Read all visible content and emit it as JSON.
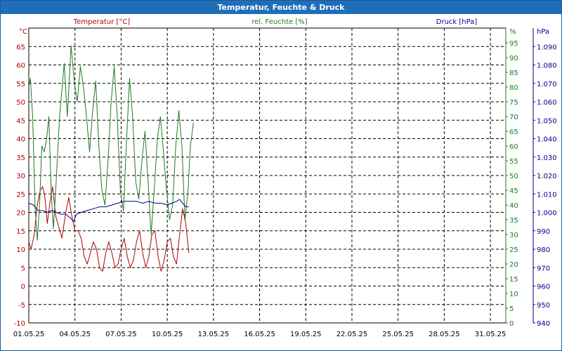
{
  "window": {
    "title": "Temperatur, Feuchte & Druck"
  },
  "colors": {
    "temperature": "#b00000",
    "humidity": "#1f7a1f",
    "pressure": "#00008b",
    "title_bar": "#1f6fb8"
  },
  "chart_data": {
    "type": "line",
    "title": "Temperatur, Feuchte & Druck",
    "grid": true,
    "x": {
      "labels": [
        "01.05.25",
        "04.05.25",
        "07.05.25",
        "10.05.25",
        "13.05.25",
        "16.05.25",
        "19.05.25",
        "22.05.25",
        "25.05.25",
        "28.05.25",
        "31.05.25"
      ],
      "start_day": 1,
      "end_day": 32
    },
    "axes": {
      "left": {
        "unit": "°C",
        "label": "Temperatur [°C]",
        "range": [
          -10,
          70
        ],
        "ticks": [
          "-10",
          "-5",
          "0",
          "5",
          "10",
          "15",
          "20",
          "25",
          "30",
          "35",
          "40",
          "45",
          "50",
          "55",
          "60",
          "65"
        ]
      },
      "middle": {
        "unit": "%",
        "label": "rel. Feuchte [%]",
        "range": [
          0,
          100
        ],
        "ticks": [
          "0",
          "5",
          "10",
          "15",
          "20",
          "25",
          "30",
          "35",
          "40",
          "45",
          "50",
          "55",
          "60",
          "65",
          "70",
          "75",
          "80",
          "85",
          "90",
          "95"
        ]
      },
      "right": {
        "unit": "hPa",
        "label": "Druck [hPa]",
        "range": [
          940,
          1100
        ],
        "ticks": [
          "940",
          "950",
          "960",
          "970",
          "980",
          "990",
          "1.000",
          "1.010",
          "1.020",
          "1.030",
          "1.040",
          "1.050",
          "1.060",
          "1.070",
          "1.080",
          "1.090"
        ]
      }
    },
    "series": [
      {
        "name": "Temperatur [°C]",
        "axis": "left",
        "color": "#b00000",
        "points": [
          [
            1.0,
            12
          ],
          [
            1.15,
            10
          ],
          [
            1.35,
            14
          ],
          [
            1.55,
            22
          ],
          [
            1.75,
            26
          ],
          [
            1.9,
            27
          ],
          [
            2.05,
            24
          ],
          [
            2.2,
            17
          ],
          [
            2.35,
            22
          ],
          [
            2.55,
            27
          ],
          [
            2.75,
            19
          ],
          [
            2.95,
            16
          ],
          [
            3.15,
            13
          ],
          [
            3.4,
            20
          ],
          [
            3.6,
            24
          ],
          [
            3.8,
            19
          ],
          [
            4.0,
            15
          ],
          [
            4.2,
            15
          ],
          [
            4.4,
            13
          ],
          [
            4.6,
            8
          ],
          [
            4.8,
            6
          ],
          [
            5.0,
            9
          ],
          [
            5.2,
            12
          ],
          [
            5.4,
            10
          ],
          [
            5.6,
            5
          ],
          [
            5.8,
            4
          ],
          [
            6.0,
            9
          ],
          [
            6.2,
            12
          ],
          [
            6.4,
            9
          ],
          [
            6.6,
            5
          ],
          [
            6.8,
            6
          ],
          [
            7.0,
            10
          ],
          [
            7.2,
            13
          ],
          [
            7.4,
            8
          ],
          [
            7.6,
            5
          ],
          [
            7.8,
            7
          ],
          [
            8.0,
            12
          ],
          [
            8.2,
            15
          ],
          [
            8.4,
            9
          ],
          [
            8.6,
            5
          ],
          [
            8.8,
            8
          ],
          [
            9.0,
            14
          ],
          [
            9.2,
            15
          ],
          [
            9.4,
            8
          ],
          [
            9.6,
            4
          ],
          [
            9.8,
            7
          ],
          [
            10.0,
            12
          ],
          [
            10.2,
            13
          ],
          [
            10.4,
            8
          ],
          [
            10.6,
            6
          ],
          [
            10.8,
            14
          ],
          [
            11.0,
            21
          ],
          [
            11.2,
            17
          ],
          [
            11.4,
            9
          ]
        ]
      },
      {
        "name": "rel. Feuchte [%]",
        "axis": "middle",
        "color": "#1f7a1f",
        "points": [
          [
            1.0,
            80
          ],
          [
            1.1,
            83
          ],
          [
            1.25,
            70
          ],
          [
            1.4,
            40
          ],
          [
            1.55,
            28
          ],
          [
            1.7,
            40
          ],
          [
            1.85,
            60
          ],
          [
            2.0,
            58
          ],
          [
            2.15,
            62
          ],
          [
            2.3,
            70
          ],
          [
            2.45,
            45
          ],
          [
            2.6,
            32
          ],
          [
            2.75,
            45
          ],
          [
            3.0,
            70
          ],
          [
            3.3,
            88
          ],
          [
            3.5,
            70
          ],
          [
            3.75,
            94
          ],
          [
            3.95,
            82
          ],
          [
            4.15,
            75
          ],
          [
            4.35,
            87
          ],
          [
            4.55,
            80
          ],
          [
            4.75,
            70
          ],
          [
            4.95,
            58
          ],
          [
            5.15,
            72
          ],
          [
            5.35,
            82
          ],
          [
            5.55,
            60
          ],
          [
            5.75,
            45
          ],
          [
            5.95,
            40
          ],
          [
            6.15,
            55
          ],
          [
            6.35,
            75
          ],
          [
            6.55,
            87
          ],
          [
            6.75,
            70
          ],
          [
            6.95,
            45
          ],
          [
            7.15,
            38
          ],
          [
            7.35,
            62
          ],
          [
            7.55,
            83
          ],
          [
            7.75,
            70
          ],
          [
            7.95,
            48
          ],
          [
            8.15,
            42
          ],
          [
            8.35,
            55
          ],
          [
            8.55,
            65
          ],
          [
            8.75,
            48
          ],
          [
            8.95,
            30
          ],
          [
            9.15,
            45
          ],
          [
            9.35,
            62
          ],
          [
            9.55,
            70
          ],
          [
            9.75,
            58
          ],
          [
            9.95,
            45
          ],
          [
            10.15,
            35
          ],
          [
            10.35,
            40
          ],
          [
            10.55,
            60
          ],
          [
            10.75,
            72
          ],
          [
            10.95,
            60
          ],
          [
            11.15,
            35
          ],
          [
            11.35,
            45
          ],
          [
            11.5,
            60
          ],
          [
            11.7,
            68
          ]
        ]
      },
      {
        "name": "Druck [hPa]",
        "axis": "right",
        "color": "#00008b",
        "points": [
          [
            1.0,
            1005
          ],
          [
            1.3,
            1004
          ],
          [
            1.6,
            1001
          ],
          [
            1.9,
            1001
          ],
          [
            2.2,
            1000
          ],
          [
            2.5,
            1001
          ],
          [
            2.8,
            1000
          ],
          [
            3.1,
            999
          ],
          [
            3.4,
            999
          ],
          [
            3.7,
            997
          ],
          [
            3.9,
            995
          ],
          [
            4.1,
            999
          ],
          [
            4.4,
            1000
          ],
          [
            4.8,
            1001
          ],
          [
            5.2,
            1002
          ],
          [
            5.6,
            1003
          ],
          [
            6.0,
            1003
          ],
          [
            6.4,
            1004
          ],
          [
            6.8,
            1005
          ],
          [
            7.2,
            1006
          ],
          [
            7.6,
            1006
          ],
          [
            8.0,
            1006
          ],
          [
            8.4,
            1005
          ],
          [
            8.8,
            1006
          ],
          [
            9.2,
            1005
          ],
          [
            9.6,
            1005
          ],
          [
            10.0,
            1004
          ],
          [
            10.3,
            1005
          ],
          [
            10.6,
            1006
          ],
          [
            10.8,
            1007
          ],
          [
            11.0,
            1005
          ],
          [
            11.2,
            1003
          ],
          [
            11.4,
            1003
          ]
        ]
      }
    ]
  }
}
